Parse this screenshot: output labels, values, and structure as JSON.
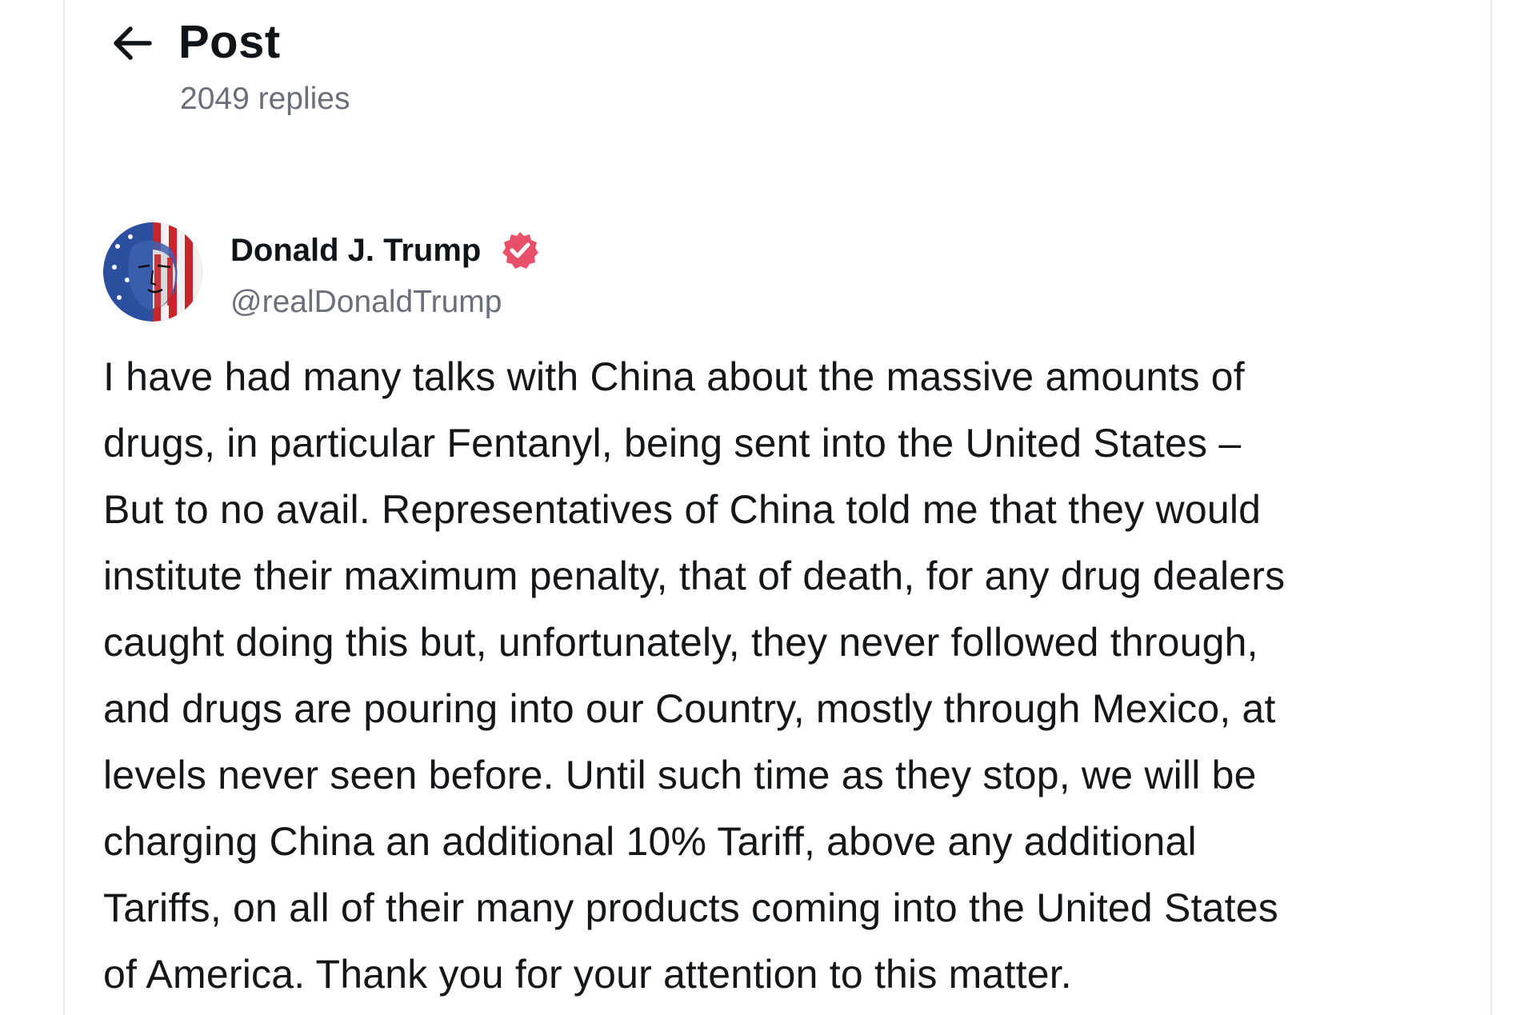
{
  "header": {
    "back_icon": "arrow-left-icon",
    "title": "Post",
    "replies": "2049 replies"
  },
  "post": {
    "author": {
      "name": "Donald J. Trump",
      "handle": "@realDonaldTrump",
      "verified_icon": "verified-badge-icon",
      "avatar_icon": "user-avatar"
    },
    "body_lines": [
      "I have had many talks with China about the massive amounts of",
      "drugs, in particular Fentanyl, being sent into the United States –",
      "But to no avail. Representatives of China told me that they would",
      "institute their maximum penalty, that of death, for any drug dealers",
      "caught doing this but, unfortunately, they never followed through,",
      "and drugs are pouring into our Country, mostly through Mexico, at",
      "levels never seen before. Until such time as they stop, we will be",
      "charging China an additional 10% Tariff, above any additional",
      "Tariffs, on all of their many products coming into the United States",
      "of America. Thank you for your attention to this matter."
    ]
  },
  "colors": {
    "text_primary": "#0f1419",
    "text_secondary": "#6b6f7b",
    "verified": "#e8506a",
    "border": "#e9e9ee"
  }
}
